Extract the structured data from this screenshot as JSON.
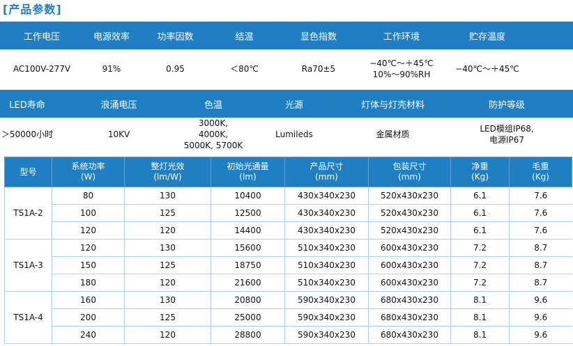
{
  "title": "[产品参数]",
  "accent_color": "#1f7fc2",
  "params1": {
    "headers": [
      "工作电压",
      "电源效率",
      "功率因数",
      "结温",
      "显色指数",
      "工作环境",
      "贮存温度"
    ],
    "values": [
      "AC100V-277V",
      "91%",
      "0.95",
      "＜80℃",
      "Ra70±5",
      "−40℃～＋45℃\n10%～90%RH",
      "−40℃～＋45℃"
    ]
  },
  "params2": {
    "headers": [
      "LED寿命",
      "浪涌电压",
      "色温",
      "光源",
      "灯体与灯壳材料",
      "防护等级"
    ],
    "values": [
      "＞50000小时",
      "10KV",
      "3000K, 4000K,\n5000K, 5700K",
      "Lumileds",
      "金属材质",
      "LED模组IP68,\n电源IP67"
    ]
  },
  "spec_table": {
    "headers": [
      "型号",
      "系统功率\n(W)",
      "整灯光效\n(lm/W)",
      "初始光通量\n(lm)",
      "产品尺寸\n(mm)",
      "包装尺寸\n(mm)",
      "净重\n(Kg)",
      "毛重\n(Kg)"
    ],
    "groups": [
      {
        "model": "TS1A-2",
        "rows": [
          [
            "80",
            "130",
            "10400",
            "430x340x230",
            "520x430x230",
            "6.1",
            "7.6"
          ],
          [
            "100",
            "125",
            "12500",
            "430x340x230",
            "520x430x230",
            "6.1",
            "7.6"
          ],
          [
            "120",
            "120",
            "14400",
            "430x340x230",
            "520x430x230",
            "6.1",
            "7.6"
          ]
        ]
      },
      {
        "model": "TS1A-3",
        "rows": [
          [
            "120",
            "130",
            "15600",
            "510x340x230",
            "600x430x230",
            "7.2",
            "8.7"
          ],
          [
            "150",
            "125",
            "18750",
            "510x340x230",
            "600x430x230",
            "7.2",
            "8.7"
          ],
          [
            "180",
            "120",
            "21600",
            "510x340x230",
            "600x430x230",
            "7.2",
            "8.7"
          ]
        ]
      },
      {
        "model": "TS1A-4",
        "rows": [
          [
            "160",
            "130",
            "20800",
            "590x340x230",
            "680x430x230",
            "8.1",
            "9.6"
          ],
          [
            "200",
            "125",
            "25000",
            "590x340x230",
            "680x430x230",
            "8.1",
            "9.6"
          ],
          [
            "240",
            "120",
            "28800",
            "590x340x230",
            "680x430x230",
            "8.1",
            "9.6"
          ]
        ]
      }
    ]
  }
}
